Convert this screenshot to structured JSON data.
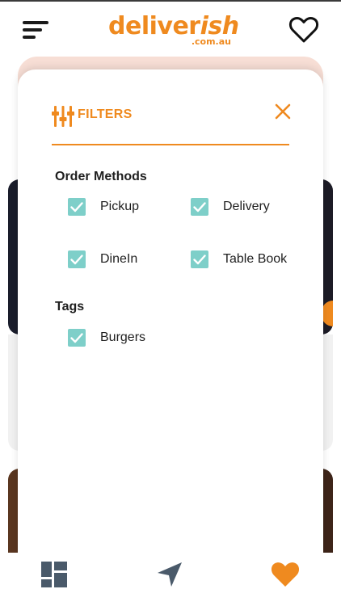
{
  "header": {
    "logo_main": "deliver",
    "logo_accent": "ish",
    "logo_sub": ".com.au",
    "icons": {
      "menu": "hamburger-menu-icon",
      "favorites": "heart-outline-icon"
    }
  },
  "filters": {
    "title": "FILTERS",
    "icons": {
      "title": "filter-sliders-icon",
      "close": "close-icon"
    },
    "order_methods": {
      "title": "Order Methods",
      "options": [
        {
          "label": "Pickup",
          "checked": true
        },
        {
          "label": "Delivery",
          "checked": true
        },
        {
          "label": "DineIn",
          "checked": true
        },
        {
          "label": "Table Book",
          "checked": true
        }
      ]
    },
    "tags": {
      "title": "Tags",
      "options": [
        {
          "label": "Burgers",
          "checked": true
        }
      ]
    }
  },
  "bottom_nav": {
    "items": [
      {
        "icon": "dashboard-grid-icon",
        "active": false
      },
      {
        "icon": "navigation-arrow-icon",
        "active": false
      },
      {
        "icon": "heart-filled-icon",
        "active": true
      }
    ]
  },
  "colors": {
    "accent": "#ef8a1f",
    "checkbox": "#7ecfc9",
    "nav_icon": "#4a5a6a",
    "text": "#1f1f1f"
  }
}
